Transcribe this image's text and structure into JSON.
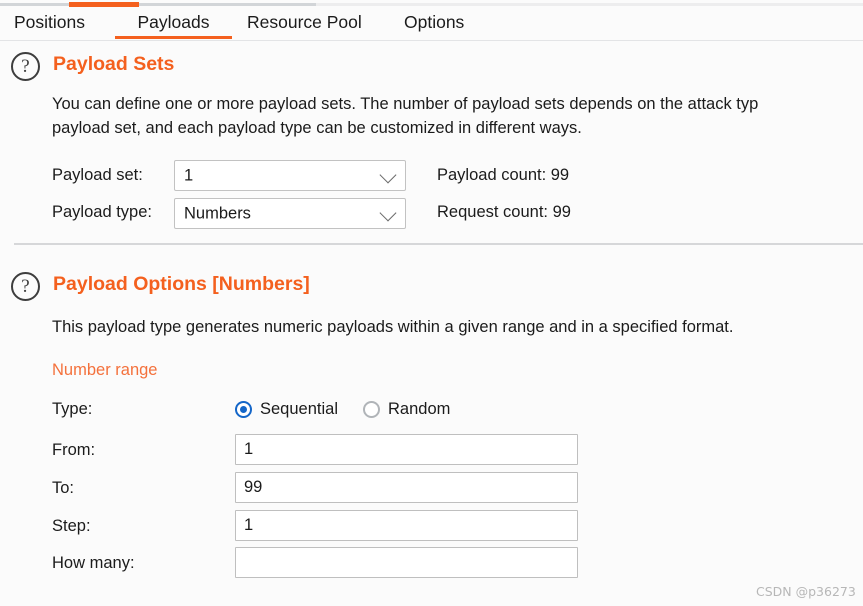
{
  "window": {
    "app": "Burp Suite Intruder",
    "background_color": "#fbfbfb",
    "accent_color": "#f4601e",
    "radio_accent_color": "#1466c8"
  },
  "tabs": {
    "items": [
      {
        "label": "Positions",
        "active": false
      },
      {
        "label": "Payloads",
        "active": true
      },
      {
        "label": "Resource Pool",
        "active": false
      },
      {
        "label": "Options",
        "active": false
      }
    ]
  },
  "payload_sets": {
    "help_icon": "question-circle-icon",
    "title": "Payload Sets",
    "description_line1": "You can define one or more payload sets. The number of payload sets depends on the attack typ",
    "description_line2": "payload set, and each payload type can be customized in different ways.",
    "payload_set": {
      "label": "Payload set:",
      "value": "1",
      "chevron": "chevron-down-icon"
    },
    "payload_type": {
      "label": "Payload type:",
      "value": "Numbers",
      "chevron": "chevron-down-icon"
    },
    "payload_count": "Payload count: 99",
    "request_count": "Request count: 99"
  },
  "payload_options": {
    "help_icon": "question-circle-icon",
    "title": "Payload Options [Numbers]",
    "description": "This payload type generates numeric payloads within a given range and in a specified format.",
    "number_range": {
      "heading": "Number range",
      "type_label": "Type:",
      "options": [
        {
          "label": "Sequential",
          "checked": true
        },
        {
          "label": "Random",
          "checked": false
        }
      ],
      "fields": [
        {
          "label": "From:",
          "value": "1",
          "placeholder": ""
        },
        {
          "label": "To:",
          "value": "99",
          "placeholder": ""
        },
        {
          "label": "Step:",
          "value": "1",
          "placeholder": ""
        },
        {
          "label": "How many:",
          "value": "",
          "placeholder": ""
        }
      ]
    }
  },
  "watermark": {
    "text": "CSDN @p36273"
  }
}
